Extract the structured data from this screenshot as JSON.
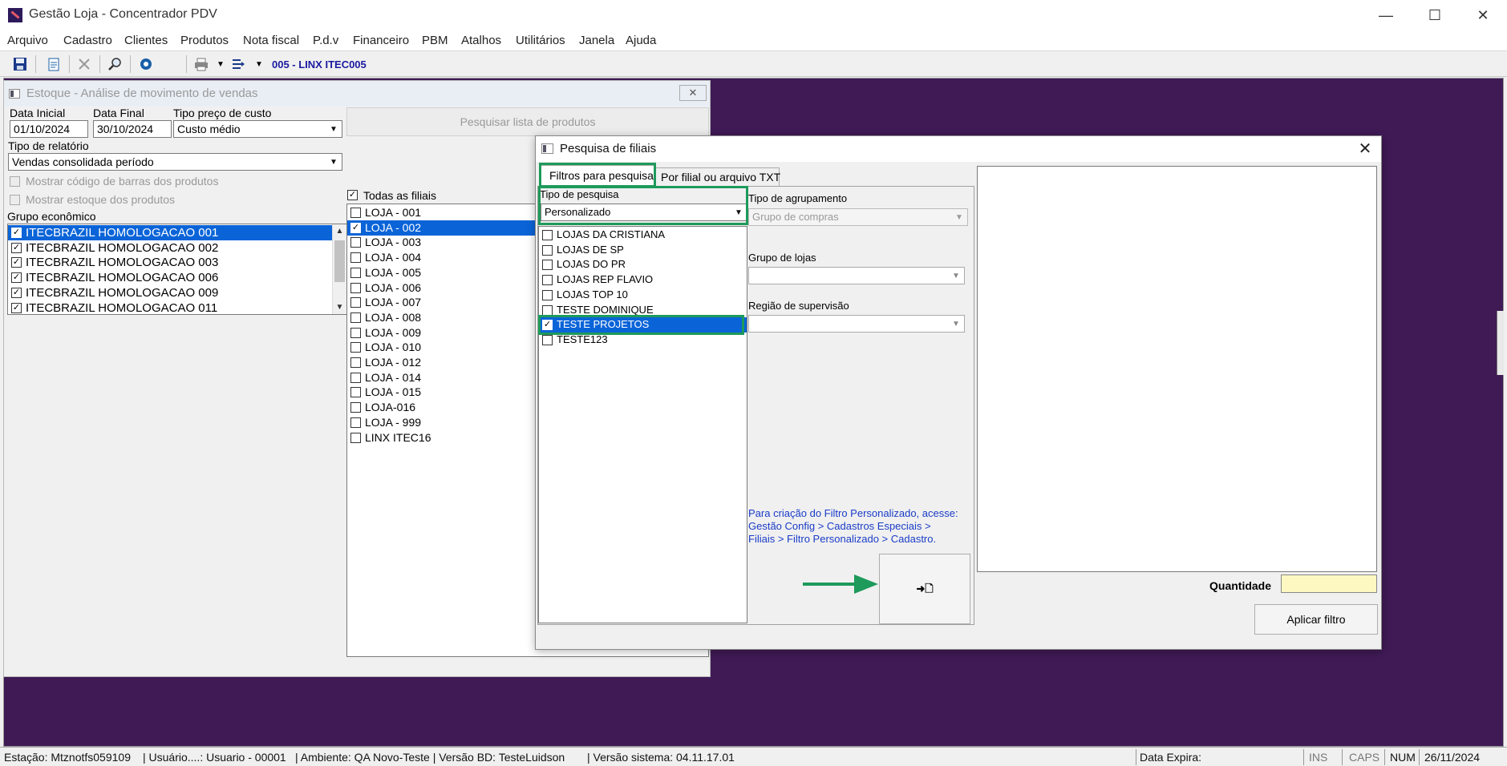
{
  "app": {
    "title": "Gestão Loja - Concentrador PDV"
  },
  "window_controls": {
    "minimize": "—",
    "maximize": "☐",
    "close": "✕"
  },
  "menu": [
    "Arquivo",
    "Cadastro",
    "Clientes",
    "Produtos",
    "Nota fiscal",
    "P.d.v",
    "Financeiro",
    "PBM",
    "Atalhos",
    "Utilitários",
    "Janela",
    "Ajuda"
  ],
  "toolbar": {
    "icons": [
      "save-icon",
      "new-document-icon",
      "delete-icon",
      "search-icon",
      "settings-icon",
      "print-icon",
      "export-icon"
    ],
    "store_label": "005 - LINX ITEC005"
  },
  "estoque_window": {
    "title": "Estoque - Análise de movimento de vendas",
    "close": "✕",
    "data_inicial_label": "Data Inicial",
    "data_inicial": "01/10/2024",
    "data_final_label": "Data Final",
    "data_final": "30/10/2024",
    "tipo_preco_label": "Tipo preço de custo",
    "tipo_preco": "Custo médio",
    "tipo_relatorio_label": "Tipo de relatório",
    "tipo_relatorio": "Vendas consolidada período",
    "mostrar_codigo": "Mostrar código de barras dos produtos",
    "mostrar_estoque": "Mostrar estoque dos produtos",
    "grupo_label": "Grupo econômico",
    "grupos": [
      {
        "label": "ITECBRAZIL HOMOLOGACAO 001",
        "checked": true,
        "selected": true
      },
      {
        "label": "ITECBRAZIL HOMOLOGACAO 002",
        "checked": true,
        "selected": false
      },
      {
        "label": "ITECBRAZIL HOMOLOGACAO 003",
        "checked": true,
        "selected": false
      },
      {
        "label": "ITECBRAZIL HOMOLOGACAO 006",
        "checked": true,
        "selected": false
      },
      {
        "label": "ITECBRAZIL HOMOLOGACAO 009",
        "checked": true,
        "selected": false
      },
      {
        "label": "ITECBRAZIL HOMOLOGACAO 011",
        "checked": true,
        "selected": false
      }
    ],
    "pesquisar_button": "Pesquisar lista de produtos",
    "todas_filiais": "Todas as filiais",
    "lojas": [
      {
        "label": "LOJA - 001",
        "checked": false,
        "selected": false
      },
      {
        "label": "LOJA - 002",
        "checked": true,
        "selected": true
      },
      {
        "label": "LOJA - 003",
        "checked": false,
        "selected": false
      },
      {
        "label": "LOJA - 004",
        "checked": false,
        "selected": false
      },
      {
        "label": "LOJA - 005",
        "checked": false,
        "selected": false
      },
      {
        "label": "LOJA - 006",
        "checked": false,
        "selected": false
      },
      {
        "label": "LOJA - 007",
        "checked": false,
        "selected": false
      },
      {
        "label": "LOJA - 008",
        "checked": false,
        "selected": false
      },
      {
        "label": "LOJA - 009",
        "checked": false,
        "selected": false
      },
      {
        "label": "LOJA - 010",
        "checked": false,
        "selected": false
      },
      {
        "label": "LOJA - 012",
        "checked": false,
        "selected": false
      },
      {
        "label": "LOJA - 014",
        "checked": false,
        "selected": false
      },
      {
        "label": "LOJA - 015",
        "checked": false,
        "selected": false
      },
      {
        "label": "LOJA-016",
        "checked": false,
        "selected": false
      },
      {
        "label": "LOJA - 999",
        "checked": false,
        "selected": false
      },
      {
        "label": "LINX ITEC16",
        "checked": false,
        "selected": false
      }
    ]
  },
  "filiais_dialog": {
    "title": "Pesquisa de filiais",
    "close": "✕",
    "tab_filtros": "Filtros para pesquisa",
    "tab_por_filial": "Por filial ou arquivo TXT",
    "tipo_pesquisa_label": "Tipo de pesquisa",
    "tipo_pesquisa": "Personalizado",
    "filtros": [
      {
        "label": "LOJAS DA CRISTIANA",
        "checked": false,
        "selected": false
      },
      {
        "label": "LOJAS DE SP",
        "checked": false,
        "selected": false
      },
      {
        "label": "LOJAS DO PR",
        "checked": false,
        "selected": false
      },
      {
        "label": "LOJAS REP FLAVIO",
        "checked": false,
        "selected": false
      },
      {
        "label": "LOJAS TOP 10",
        "checked": false,
        "selected": false
      },
      {
        "label": "TESTE DOMINIQUE",
        "checked": false,
        "selected": false
      },
      {
        "label": "TESTE PROJETOS",
        "checked": true,
        "selected": true
      },
      {
        "label": "TESTE123",
        "checked": false,
        "selected": false
      }
    ],
    "tipo_agrupamento_label": "Tipo de agrupamento",
    "tipo_agrupamento": "Grupo de compras",
    "grupo_lojas_label": "Grupo de lojas",
    "grupo_lojas": "",
    "regiao_label": "Região de supervisão",
    "regiao": "",
    "info_lines": [
      "Para criação do Filtro Personalizado, acesse:",
      "Gestão Config > Cadastros Especiais >",
      "Filiais > Filtro Personalizado > Cadastro."
    ],
    "add_icon": "➜🗋",
    "quantidade_label": "Quantidade",
    "quantidade": "",
    "aplicar_button": "Aplicar filtro"
  },
  "status": {
    "estacao": "Estação: Mtznotfs059109",
    "usuario": "| Usuário....: Usuario - 00001",
    "ambiente": "| Ambiente: QA Novo-Teste | Versão BD: TesteLuidson",
    "versao": "| Versão sistema: 04.11.17.01",
    "data_expira": "Data Expira:",
    "ins": "INS",
    "caps": "CAPS",
    "num": "NUM",
    "date": "26/11/2024"
  },
  "colors": {
    "desktop": "#3f1a55",
    "selection": "#0a64d8",
    "highlight": "#1e9a5a",
    "info_text": "#1a3cc8",
    "quantity_field": "#fdf7c2"
  }
}
